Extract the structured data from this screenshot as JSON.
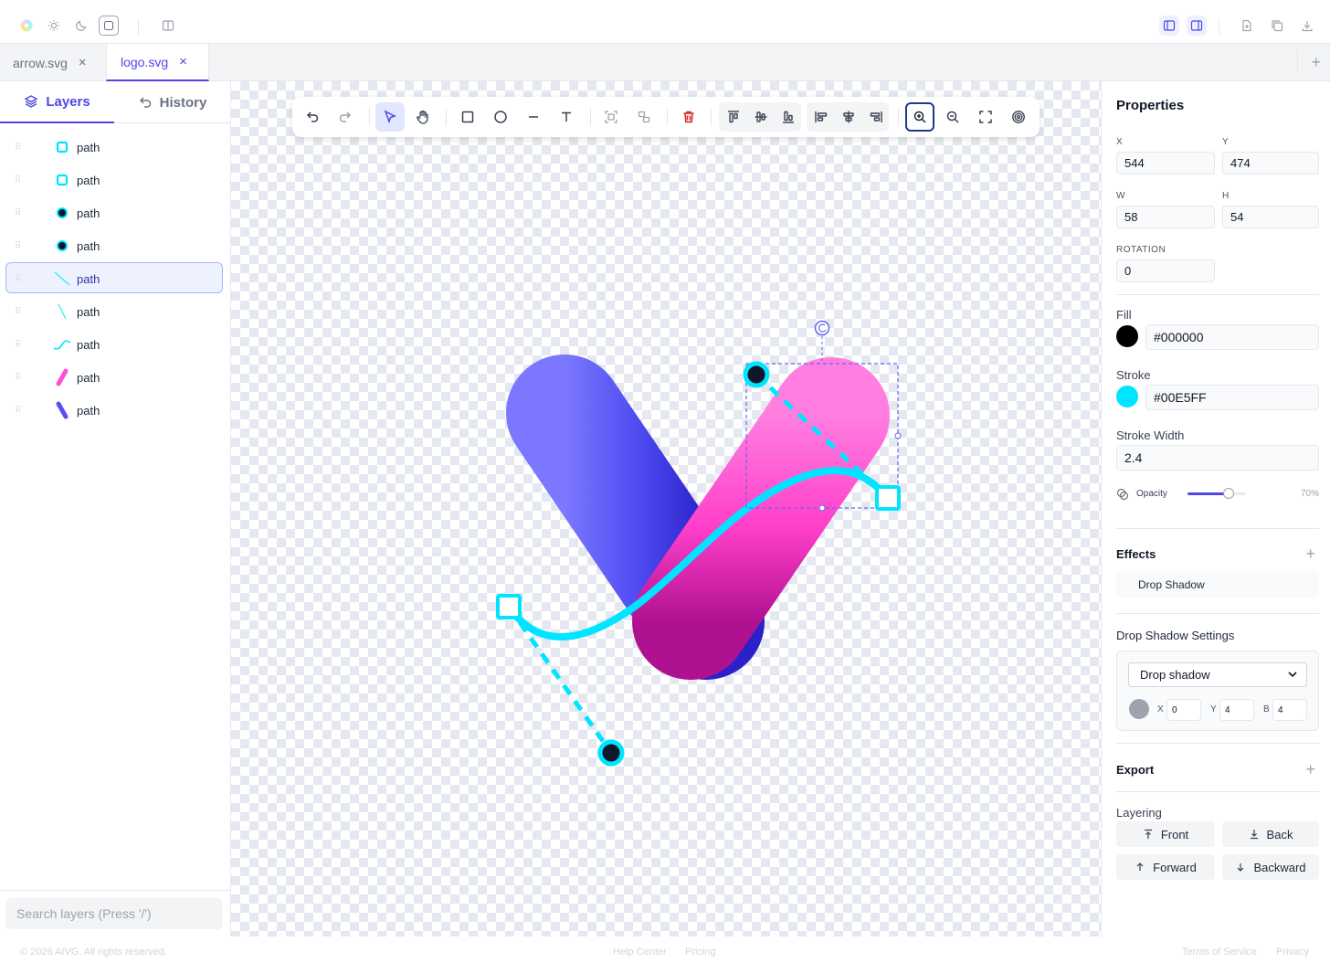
{
  "topbar": {
    "left_icons": [
      "palette-icon",
      "sun-icon",
      "moon-icon",
      "system-theme-icon",
      "sidebar-toggle-icon"
    ],
    "right_icons": [
      "left-panel-icon",
      "right-panel-icon",
      "import-icon",
      "copy-icon",
      "download-icon"
    ]
  },
  "tabs": [
    {
      "label": "arrow.svg",
      "close": "×",
      "active": false
    },
    {
      "label": "logo.svg",
      "close": "×",
      "active": true
    }
  ],
  "tab_add": "+",
  "left_panel": {
    "tabs": [
      {
        "label": "Layers",
        "icon": "layers-icon",
        "active": true
      },
      {
        "label": "History",
        "icon": "undo-icon",
        "active": false
      }
    ],
    "layers": [
      {
        "name": "path",
        "thumb": "cyan-square"
      },
      {
        "name": "path",
        "thumb": "cyan-square"
      },
      {
        "name": "path",
        "thumb": "cyan-dot"
      },
      {
        "name": "path",
        "thumb": "cyan-dot"
      },
      {
        "name": "path",
        "thumb": "dashed-line",
        "selected": true
      },
      {
        "name": "path",
        "thumb": "dashed-line"
      },
      {
        "name": "path",
        "thumb": "cyan-curve"
      },
      {
        "name": "path",
        "thumb": "pink-pill"
      },
      {
        "name": "path",
        "thumb": "blue-pill"
      }
    ],
    "search_placeholder": "Search layers (Press '/')"
  },
  "toolbar": {
    "tools": [
      "undo-icon",
      "redo-icon",
      "select-icon",
      "hand-icon",
      "rectangle-icon",
      "ellipse-icon",
      "line-icon",
      "text-icon",
      "group-icon",
      "ungroup-icon",
      "delete-icon",
      "align-top-icon",
      "align-middle-icon",
      "align-bottom-icon",
      "align-left-icon",
      "align-center-icon",
      "align-right-icon",
      "zoom-in-icon",
      "zoom-out-icon",
      "fit-screen-icon",
      "target-icon"
    ],
    "active_tool": "select-icon"
  },
  "properties": {
    "title": "Properties",
    "x_label": "X",
    "x": "544",
    "y_label": "Y",
    "y": "474",
    "w_label": "W",
    "w": "58",
    "h_label": "H",
    "h": "54",
    "rotation_label": "ROTATION",
    "rotation": "0",
    "fill_label": "Fill",
    "fill_value": "#000000",
    "fill_color": "#000000",
    "stroke_label": "Stroke",
    "stroke_value": "#00E5FF",
    "stroke_color": "#00E5FF",
    "stroke_width_label": "Stroke Width",
    "stroke_width": "2.4",
    "opacity_label": "Opacity",
    "opacity_text": "70%",
    "opacity": 0.7
  },
  "effects": {
    "title": "Effects",
    "add": "+",
    "items": [
      "Drop Shadow"
    ]
  },
  "drop_shadow": {
    "title": "Drop Shadow Settings",
    "type": "Drop shadow",
    "color": "#9ca3af",
    "x_label": "X",
    "x": "0",
    "y_label": "Y",
    "y": "4",
    "b_label": "B",
    "b": "4"
  },
  "export": {
    "title": "Export",
    "add": "+"
  },
  "layering": {
    "title": "Layering",
    "front": "Front",
    "back": "Back",
    "forward": "Forward",
    "backward": "Backward"
  },
  "footer": {
    "copyright": "© 2026 AIVG. All rights reserved.",
    "help": "Help Center",
    "pricing": "Pricing",
    "terms": "Terms of Service",
    "privacy": "Privacy"
  },
  "colors": {
    "accent": "#4F46E5",
    "cyan": "#00E5FF",
    "pink": "#FF4FD8",
    "blue": "#5B4EF5"
  }
}
